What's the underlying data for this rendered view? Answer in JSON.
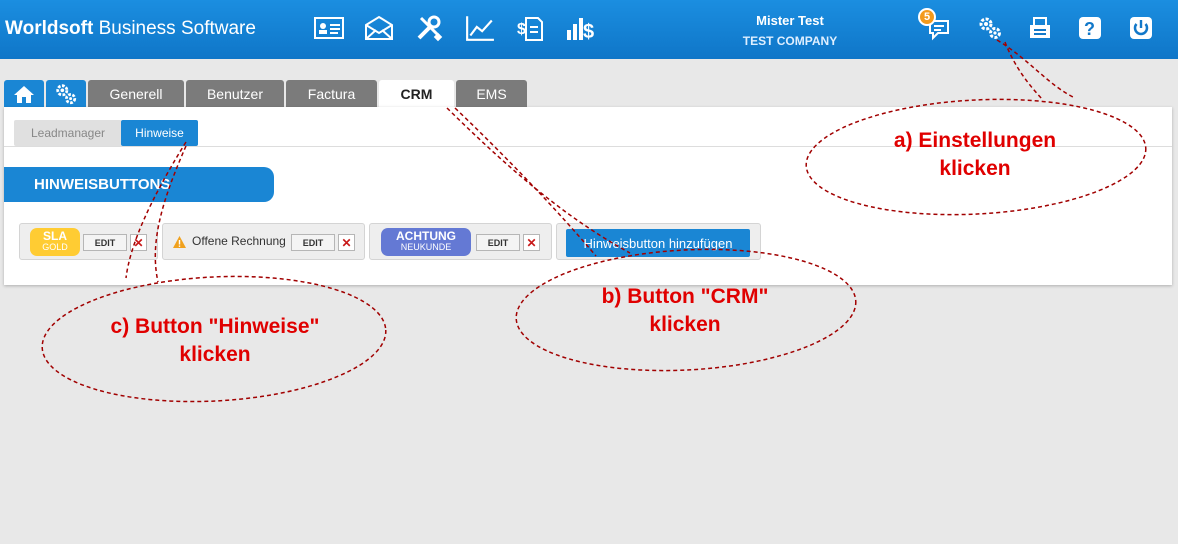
{
  "header": {
    "brand_bold": "Worldsoft",
    "brand_rest": " Business Software",
    "user_name": "Mister Test",
    "company": "TEST COMPANY",
    "notification_count": "5"
  },
  "tabs": [
    {
      "label": ""
    },
    {
      "label": ""
    },
    {
      "label": "Generell"
    },
    {
      "label": "Benutzer"
    },
    {
      "label": "Factura"
    },
    {
      "label": "CRM"
    },
    {
      "label": "EMS"
    }
  ],
  "subtabs": [
    {
      "label": "Leadmanager"
    },
    {
      "label": "Hinweise"
    }
  ],
  "section_title": "HINWEISBUTTONS",
  "hint_buttons": [
    {
      "line1": "SLA",
      "line2": "GOLD",
      "color": "#ffcc33",
      "edit": "EDIT",
      "delete": "✕"
    },
    {
      "text": "Offene Rechnung",
      "edit": "EDIT",
      "delete": "✕"
    },
    {
      "line1": "ACHTUNG",
      "line2": "NEUKUNDE",
      "color": "#6479d4",
      "edit": "EDIT",
      "delete": "✕"
    }
  ],
  "add_button": "Hinweisbutton hinzufügen",
  "annotations": {
    "a": [
      "a) Einstellungen",
      "klicken"
    ],
    "b": [
      "b) Button \"CRM\"",
      "klicken"
    ],
    "c": [
      "c) Button \"Hinweise\"",
      "klicken"
    ]
  },
  "colors": {
    "primary": "#1a86d4",
    "annotation": "#e00000"
  }
}
